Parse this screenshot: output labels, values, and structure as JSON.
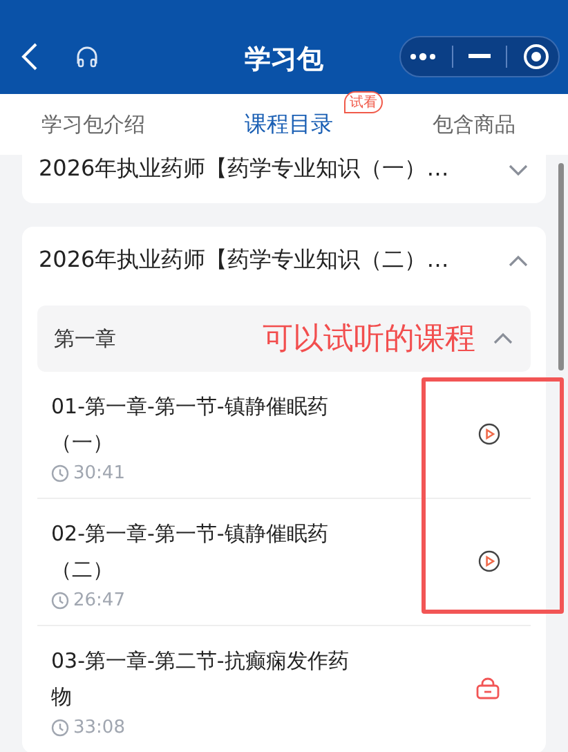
{
  "header": {
    "title": "学习包"
  },
  "tabs": [
    {
      "label": "学习包介绍",
      "selected": false
    },
    {
      "label": "课程目录",
      "selected": true,
      "badge": "试看"
    },
    {
      "label": "包含商品",
      "selected": false
    }
  ],
  "courses": [
    {
      "title": "2026年执业药师【药学专业知识（一）…",
      "expanded": false
    },
    {
      "title": "2026年执业药师【药学专业知识（二）…",
      "expanded": true,
      "chapters": [
        {
          "title": "第一章",
          "expanded": true,
          "note": "可以试听的课程",
          "lessons": [
            {
              "title": "01-第一章-第一节-镇静催眠药（一）",
              "duration": "30:41",
              "kind": "trial"
            },
            {
              "title": "02-第一章-第一节-镇静催眠药（二）",
              "duration": "26:47",
              "kind": "trial"
            },
            {
              "title": "03-第一章-第二节-抗癫痫发作药物",
              "duration": "33:08",
              "kind": "locked"
            }
          ]
        }
      ]
    }
  ]
}
